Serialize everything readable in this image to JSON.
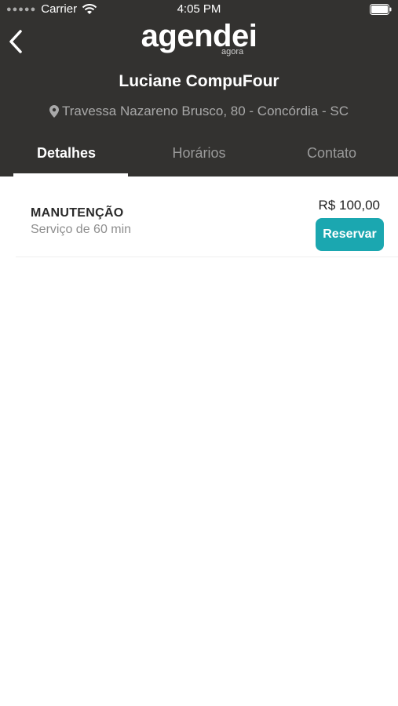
{
  "status_bar": {
    "carrier": "Carrier",
    "time": "4:05 PM"
  },
  "header": {
    "logo_main": "agendei",
    "logo_sub": "agora",
    "business_name": "Luciane CompuFour",
    "address": "Travessa Nazareno Brusco, 80 - Concórdia - SC"
  },
  "tabs": [
    {
      "label": "Detalhes",
      "active": true
    },
    {
      "label": "Horários",
      "active": false
    },
    {
      "label": "Contato",
      "active": false
    }
  ],
  "services": [
    {
      "name": "MANUTENÇÃO",
      "duration": "Serviço de 60 min",
      "price": "R$ 100,00",
      "button_label": "Reservar"
    }
  ],
  "colors": {
    "header_bg": "#333230",
    "accent": "#1ba7b0",
    "tab_inactive": "#9a9a9a"
  }
}
